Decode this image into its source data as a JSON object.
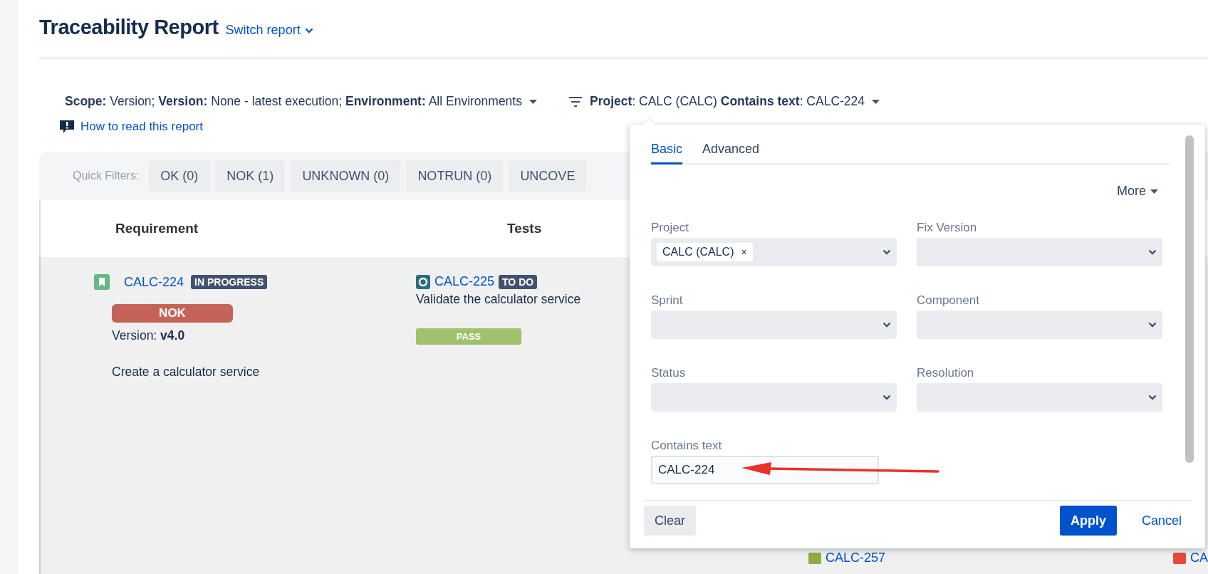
{
  "header": {
    "title": "Traceability Report",
    "switch_link": "Switch report"
  },
  "scope_line": "**Scope:** Version;  **Version:** None - latest execution;  **Environment:** All Environments",
  "filter_line": "**Project**: CALC (CALC) **Contains text**: CALC-224",
  "help_link": "How to read this report",
  "quick_filters": {
    "label": "Quick Filters:",
    "items": [
      "OK (0)",
      "NOK (1)",
      "UNKNOWN (0)",
      "NOTRUN (0)",
      "UNCOVE"
    ]
  },
  "table": {
    "columns": [
      "Requirement",
      "Tests"
    ],
    "requirement": {
      "key": "CALC-224",
      "status": "IN PROGRESS",
      "result": {
        "text": "NOK",
        "kind": "fail"
      },
      "version_label": "Version:",
      "version": "v4.0",
      "summary": "Create a calculator service"
    },
    "test": {
      "key": "CALC-225",
      "status": "TO DO",
      "summary": "Validate the calculator service",
      "result": {
        "text": "PASS",
        "kind": "pass"
      }
    },
    "partial_row": [
      {
        "key": "CALC-257",
        "kind": "story"
      },
      {
        "key": "CA",
        "kind": "bug"
      }
    ]
  },
  "filter_popup": {
    "tabs": [
      {
        "label": "Basic",
        "selected": true
      },
      {
        "label": "Advanced",
        "selected": false
      }
    ],
    "more": "More",
    "fields": [
      {
        "label": "Project",
        "chips": [
          {
            "label": "CALC (CALC)",
            "remove": "×"
          }
        ]
      },
      {
        "label": "Fix Version"
      },
      {
        "label": "Sprint"
      },
      {
        "label": "Component"
      },
      {
        "label": "Status"
      },
      {
        "label": "Resolution"
      }
    ],
    "text_field": {
      "label": "Contains text",
      "value": "CALC-224"
    },
    "buttons": [
      {
        "label": "Clear",
        "kind": "secondary"
      },
      {
        "label": "Apply",
        "kind": "primary"
      },
      {
        "label": "Cancel",
        "kind": "link"
      }
    ]
  }
}
